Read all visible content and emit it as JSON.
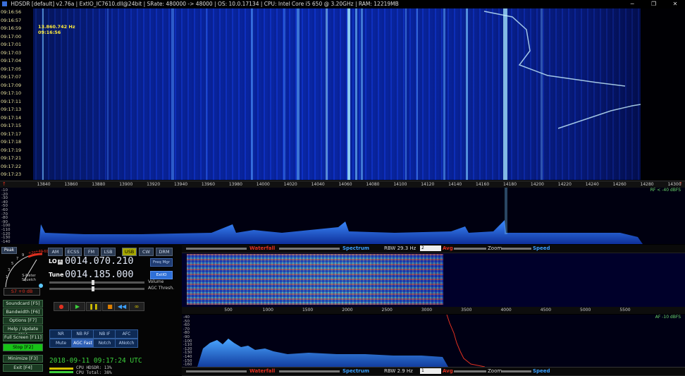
{
  "titlebar": {
    "title": "HDSDR  [default]   v2.76a  |  ExtIO_IC7610.dll@24bit  |  SRate: 480000 -> 48000  |  OS: 10.0.17134  |  CPU: Intel Core i5       650  @ 3.20GHz  |  RAM: 12219MB",
    "minimize": "─",
    "maximize": "❐",
    "close": "✕"
  },
  "waterfall": {
    "times": [
      "09:16:56",
      "09:16:57",
      "09:16:59",
      "09:17:00",
      "09:17:01",
      "09:17:03",
      "09:17:04",
      "09:17:05",
      "09:17:07",
      "09:17:09",
      "09:17:10",
      "09:17:11",
      "09:17:13",
      "09:17:14",
      "09:17:15",
      "09:17:17",
      "09:17:18",
      "09:17:19",
      "09:17:21",
      "09:17:22",
      "09:17:23"
    ],
    "readout_freq": "13.860.742 Hz",
    "readout_time": "09:16:56"
  },
  "freq_scale": {
    "labels": [
      "13840",
      "13860",
      "13880",
      "13900",
      "13920",
      "13940",
      "13960",
      "13980",
      "14000",
      "14020",
      "14040",
      "14060",
      "14080",
      "14100",
      "14120",
      "14140",
      "14160",
      "14180",
      "14200",
      "14220",
      "14240",
      "14260",
      "14280",
      "14300"
    ]
  },
  "spectrum": {
    "db_labels": [
      "-10",
      "-20",
      "-30",
      "-40",
      "-50",
      "-60",
      "-70",
      "-80",
      "-90",
      "-100",
      "-110",
      "-120",
      "-130",
      "-140"
    ],
    "rf_label": "RF < -40 dBFS"
  },
  "smeter": {
    "peak": "Peak",
    "squelch": "S-Meter\nSquelch",
    "readout": "S7 +0 dB",
    "scale": [
      "1",
      "3",
      "5",
      "7",
      "9",
      "+20",
      "+40",
      "+60"
    ]
  },
  "modes": [
    "AM",
    "ECSS",
    "FM",
    "LSB",
    "USB",
    "CW",
    "DRM"
  ],
  "active_mode": "USB",
  "lo": {
    "label": "LO",
    "value": "0014.070.210",
    "btn": "Freq Mgr"
  },
  "tune": {
    "label": "Tune",
    "value": "0014.185.000",
    "btn": "ExtIO"
  },
  "volume_label": "Volume",
  "agc_label": "AGC Thresh.",
  "left_buttons": [
    {
      "label": "Soundcard  [F5]"
    },
    {
      "label": "Bandwidth  [F6]"
    },
    {
      "label": "Options  [F7]"
    },
    {
      "label": "Help / Update  [F1]"
    },
    {
      "label": "Full Screen  [F11]"
    },
    {
      "label": "Stop  [F2]"
    },
    {
      "label": "Minimize  [F3]"
    },
    {
      "label": "Exit  [F4]"
    }
  ],
  "transport": [
    "●",
    "▶",
    "❚❚",
    "■",
    "◀◀",
    "∞"
  ],
  "func_row1": [
    "NR",
    "NB RF",
    "NB IF",
    "AFC"
  ],
  "func_row2": [
    "Mute",
    "AGC Fast",
    "Notch",
    "ANotch"
  ],
  "clock": {
    "datetime": "2018-09-11  09:17:24 UTC",
    "cpu_hdsdr": "CPU HDSDR:  13%",
    "cpu_total": "CPU Total:  38%"
  },
  "toolbar_top": {
    "waterfall": "Waterfall",
    "spectrum": "Spectrum",
    "rbw": "RBW 29.3 Hz",
    "rbw_sel": "2",
    "avg": "Avg",
    "zoom": "Zoom",
    "speed": "Speed"
  },
  "toolbar_bottom": {
    "waterfall": "Waterfall",
    "spectrum": "Spectrum",
    "rbw": "RBW 2.9 Hz",
    "rbw_sel": "1",
    "avg": "Avg",
    "zoom": "Zoom",
    "speed": "Speed"
  },
  "audio_scale": [
    "500",
    "1000",
    "1500",
    "2000",
    "2500",
    "3000",
    "3500",
    "4000",
    "4500",
    "5000",
    "5500"
  ],
  "audio_db": [
    "-40",
    "-50",
    "-60",
    "-70",
    "-80",
    "-90",
    "-100",
    "-110",
    "-120",
    "-130",
    "-140",
    "-150",
    "-160"
  ],
  "af_label": "AF -10 dBFS",
  "colors": {
    "accent_green": "#17c317",
    "waterfall_blue": "#0b2fc4",
    "label_red": "#e03020",
    "label_blue": "#3ba0ff",
    "readout_yellow": "#ffeb3b"
  }
}
